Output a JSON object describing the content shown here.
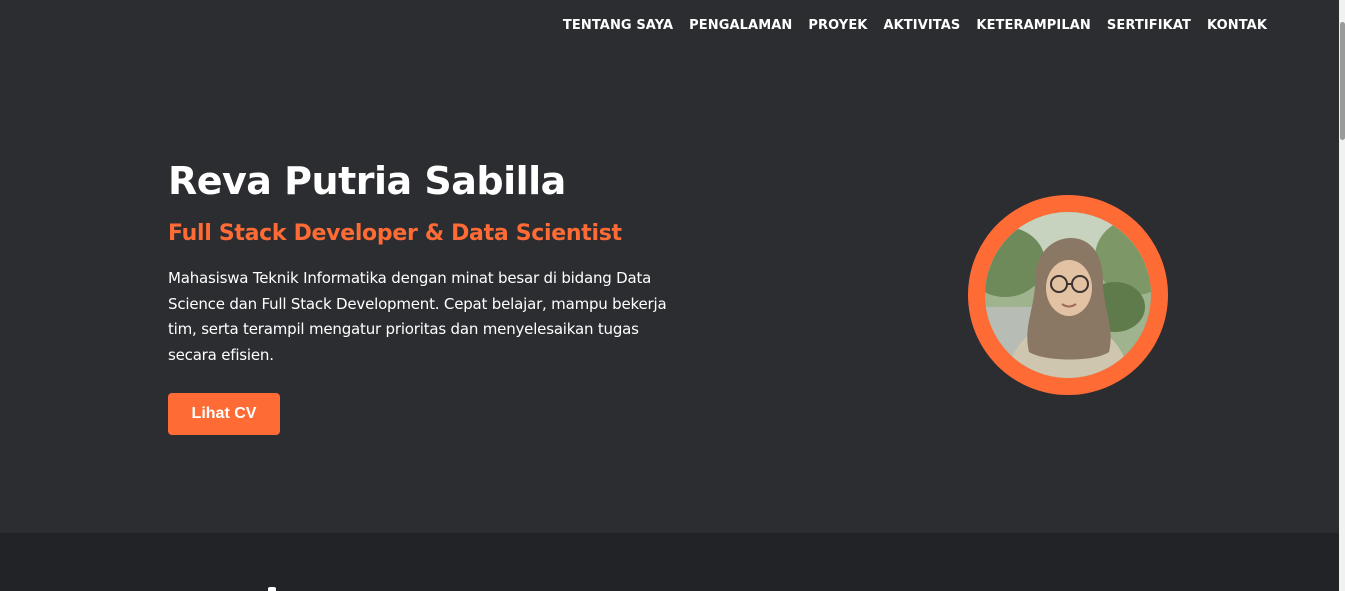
{
  "nav": {
    "items": [
      {
        "label": "TENTANG SAYA"
      },
      {
        "label": "PENGALAMAN"
      },
      {
        "label": "PROYEK"
      },
      {
        "label": "AKTIVITAS"
      },
      {
        "label": "KETERAMPILAN"
      },
      {
        "label": "SERTIFIKAT"
      },
      {
        "label": "KONTAK"
      }
    ]
  },
  "hero": {
    "name": "Reva Putria Sabilla",
    "role": "Full Stack Developer & Data Scientist",
    "description": "Mahasiswa Teknik Informatika dengan minat besar di bidang Data Science dan Full Stack Development. Cepat belajar, mampu bekerja tim, serta terampil mengatur prioritas dan menyelesaikan tugas secara efisien.",
    "cv_button_label": "Lihat CV"
  },
  "colors": {
    "background": "#2c2d31",
    "accent": "#ff6b35",
    "section_dark": "#222326",
    "text": "#ffffff"
  },
  "icons": {
    "profile_photo": "profile-photo"
  }
}
